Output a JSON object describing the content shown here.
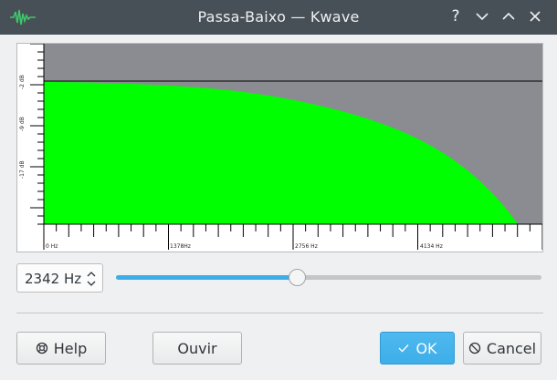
{
  "window": {
    "title": "Passa-Baixo — Kwave",
    "app_icon": "kwave-waveform-icon",
    "titlebar_buttons": [
      "help-icon",
      "minimize-icon",
      "maximize-icon",
      "close-icon"
    ],
    "help_glyph": "?"
  },
  "graph": {
    "db_labels": [
      "-2 dB",
      "-9 dB",
      "-17 dB"
    ],
    "hz_labels": [
      "0 Hz",
      "1378Hz",
      "2756 Hz",
      "4134 Hz"
    ],
    "colors": {
      "curve_fill": "#00ff00",
      "background": "#8a8c92",
      "grid": "#000000"
    }
  },
  "frequency": {
    "value": "2342 Hz",
    "slider_fraction": 0.425
  },
  "buttons": {
    "help": "Help",
    "listen": "Ouvir",
    "ok": "OK",
    "cancel": "Cancel"
  },
  "colors": {
    "accent": "#3daee9",
    "titlebar": "#475057",
    "window": "#eff0f1"
  }
}
